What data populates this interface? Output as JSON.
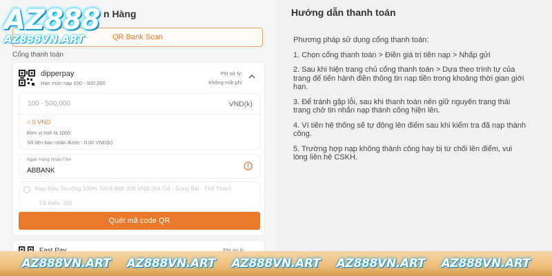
{
  "logo": {
    "main": "AZ888",
    "sub": "AZ888VN.ART"
  },
  "left": {
    "title": "n Hàng",
    "tab_label": "QR Bank Scan",
    "gate_section_label": "Cổng thanh toán",
    "gate": {
      "name": "dipperpay",
      "limit": "Hạn mức nạp 100 - 500,000",
      "fee_label": "Phí xử lý:",
      "fee_value": "Không mất phí",
      "amount_placeholder": "100 - 500,000",
      "amount_unit": "VND(k)",
      "vnd_equiv": "= 0 VND",
      "unit_note": "Đơn vị tính là 1000",
      "receive_note": "Số tiền bạn nhận được : 0.00 VND(k)",
      "bank_label": "Ngân Hàng Nhận Tiền",
      "bank_value": "ABBANK",
      "promo_text": "Nạp Đầu Thưởng 100% Tới 6.888.000 VND (Đá Gà - Sòng Bài - Thể Thao)",
      "promo_min": "Tối thiểu: 200",
      "scan_button": "Quét mã code QR"
    },
    "gate2": {
      "name": "Fast Pay",
      "fee_label": "Phí xử lý"
    }
  },
  "right": {
    "title": "Hướng dẫn thanh toán",
    "steps": [
      "Phương pháp sử dụng cổng thanh toán:",
      "1. Chọn cổng thanh toán > Điền giá trị tiền nạp > Nhấp gửi",
      "2. Sau khi hiện trang chủ cổng thanh toán > Dựa theo trình tự của trang để tiến hành điền thông tin nạp tiền trong khoảng thời gian giới hạn.",
      "3. Để tránh gặp lỗi, sau khi thanh toán nên giữ nguyên trạng thái trang chờ tin nhắn nạp thành công hiện lên.",
      "4. Ví tiền hệ thống sẽ tự động lên điểm sau khi kiểm tra đã nạp thành công.",
      "5. Trường hợp nạp không thành công hay bị từ chối lên điểm, vui lòng liên hệ CSKH."
    ]
  },
  "banner": {
    "items": [
      "AZ888VN.ART",
      "AZ888VN.ART",
      "AZ888VN.ART",
      "AZ888VN.ART",
      "AZ888VN.ART"
    ]
  },
  "colors": {
    "accent": "#ea7a2b",
    "banner": "#f0c27f",
    "glow": "#2ad6ff"
  }
}
